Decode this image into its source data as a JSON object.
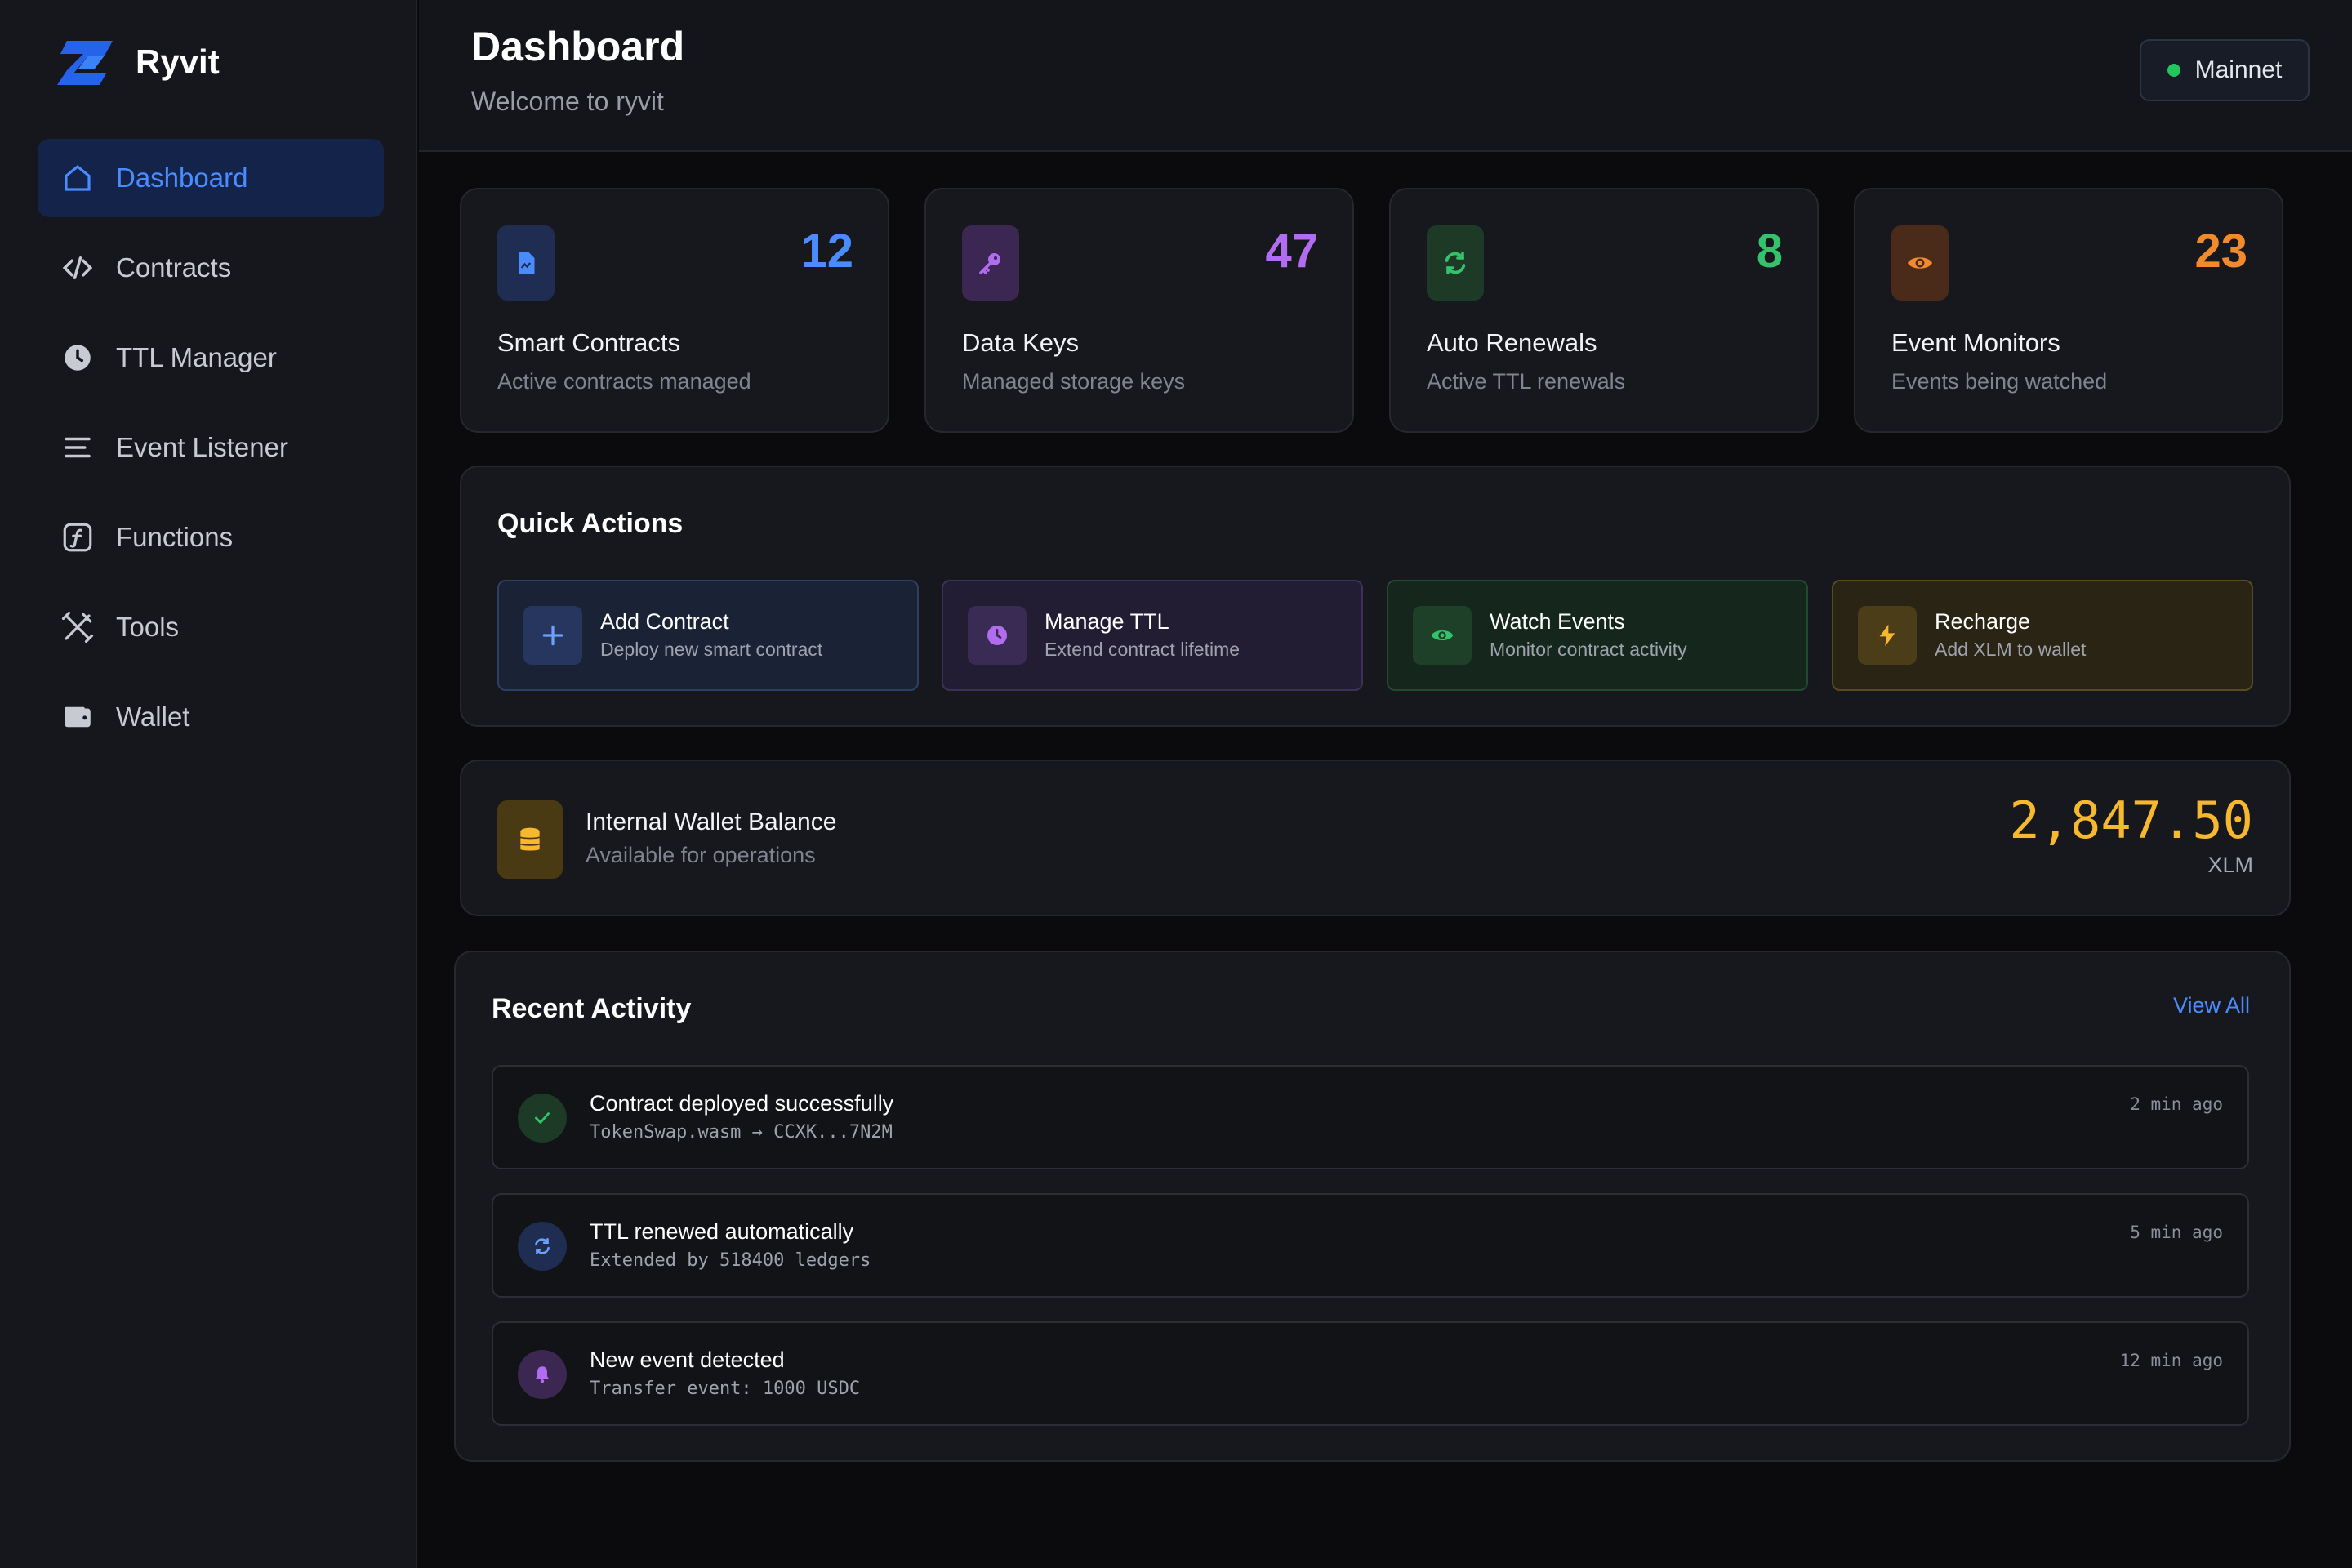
{
  "app": {
    "name": "Ryvit"
  },
  "sidebar": {
    "items": [
      {
        "label": "Dashboard",
        "icon": "home-icon",
        "active": true
      },
      {
        "label": "Contracts",
        "icon": "code-icon"
      },
      {
        "label": "TTL Manager",
        "icon": "clock-icon"
      },
      {
        "label": "Event Listener",
        "icon": "list-icon"
      },
      {
        "label": "Functions",
        "icon": "function-icon"
      },
      {
        "label": "Tools",
        "icon": "tools-icon"
      },
      {
        "label": "Wallet",
        "icon": "wallet-icon"
      }
    ]
  },
  "header": {
    "title": "Dashboard",
    "subtitle": "Welcome to ryvit",
    "network": "Mainnet"
  },
  "stats": [
    {
      "value": "12",
      "title": "Smart Contracts",
      "desc": "Active contracts managed",
      "color": "#4a8cff",
      "icon": "document-icon"
    },
    {
      "value": "47",
      "title": "Data Keys",
      "desc": "Managed storage keys",
      "color": "#b26cf0",
      "icon": "key-icon"
    },
    {
      "value": "8",
      "title": "Auto Renewals",
      "desc": "Active TTL renewals",
      "color": "#35c26c",
      "icon": "refresh-icon"
    },
    {
      "value": "23",
      "title": "Event Monitors",
      "desc": "Events being watched",
      "color": "#f08a2c",
      "icon": "eye-icon"
    }
  ],
  "quick_actions": {
    "title": "Quick Actions",
    "items": [
      {
        "title": "Add Contract",
        "sub": "Deploy new smart contract",
        "icon": "plus-icon"
      },
      {
        "title": "Manage TTL",
        "sub": "Extend contract lifetime",
        "icon": "clock-icon"
      },
      {
        "title": "Watch Events",
        "sub": "Monitor contract activity",
        "icon": "eye-icon"
      },
      {
        "title": "Recharge",
        "sub": "Add XLM to wallet",
        "icon": "lightning-icon"
      }
    ]
  },
  "wallet": {
    "title": "Internal Wallet Balance",
    "sub": "Available for operations",
    "balance": "2,847.50",
    "unit": "XLM"
  },
  "activity": {
    "title": "Recent Activity",
    "view_all": "View All",
    "items": [
      {
        "title": "Contract deployed successfully",
        "detail": "TokenSwap.wasm → CCXK...7N2M",
        "time": "2 min ago",
        "icon": "check-icon"
      },
      {
        "title": "TTL renewed automatically",
        "detail": "Extended by 518400 ledgers",
        "time": "5 min ago",
        "icon": "refresh-icon"
      },
      {
        "title": "New event detected",
        "detail": "Transfer event: 1000 USDC",
        "time": "12 min ago",
        "icon": "bell-icon"
      }
    ]
  }
}
